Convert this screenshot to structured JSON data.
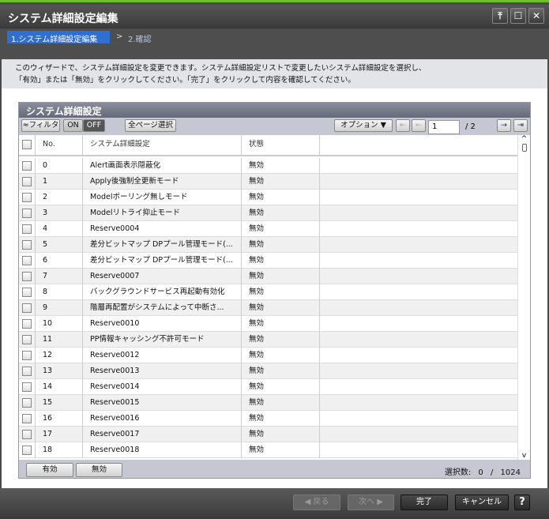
{
  "window": {
    "title": "システム詳細設定編集",
    "buttons": [
      "pin",
      "maximize",
      "close"
    ]
  },
  "wizard": {
    "steps": [
      "1.システム詳細設定編集",
      "2.確認"
    ],
    "separator": ">",
    "active_step": 0
  },
  "description": [
    "このウィザードで、システム詳細設定を変更できます。システム詳細設定リストで変更したいシステム詳細設定を選択し、",
    "「有効」または「無効」をクリックしてください。「完了」をクリックして内容を確認してください。"
  ],
  "panel": {
    "title": "システム詳細設定",
    "toolbar": {
      "filter": "≈フィルタ",
      "on": "ON",
      "off": "OFF",
      "select_all": "全ページ選択",
      "options": "オプション ▼",
      "page": "1",
      "total_pages": "/ 2"
    },
    "columns": [
      "No.",
      "システム詳細設定",
      "状態"
    ],
    "rows": [
      {
        "no": "0",
        "name": "Alert画面表示隠蔽化",
        "state": "無効"
      },
      {
        "no": "1",
        "name": "Apply後強制全更新モード",
        "state": "無効"
      },
      {
        "no": "2",
        "name": "Modelポーリング無しモード",
        "state": "無効"
      },
      {
        "no": "3",
        "name": "Modelリトライ抑止モード",
        "state": "無効"
      },
      {
        "no": "4",
        "name": "Reserve0004",
        "state": "無効"
      },
      {
        "no": "5",
        "name": "差分ビットマップ DPプール管理モード(...",
        "state": "無効"
      },
      {
        "no": "6",
        "name": "差分ビットマップ DPプール管理モード(...",
        "state": "無効"
      },
      {
        "no": "7",
        "name": "Reserve0007",
        "state": "無効"
      },
      {
        "no": "8",
        "name": "バックグラウンドサービス再起動有効化",
        "state": "無効"
      },
      {
        "no": "9",
        "name": "階層再配置がシステムによって中断さ...",
        "state": "無効"
      },
      {
        "no": "10",
        "name": "Reserve0010",
        "state": "無効"
      },
      {
        "no": "11",
        "name": "PP情報キャッシング不許可モード",
        "state": "無効"
      },
      {
        "no": "12",
        "name": "Reserve0012",
        "state": "無効"
      },
      {
        "no": "13",
        "name": "Reserve0013",
        "state": "無効"
      },
      {
        "no": "14",
        "name": "Reserve0014",
        "state": "無効"
      },
      {
        "no": "15",
        "name": "Reserve0015",
        "state": "無効"
      },
      {
        "no": "16",
        "name": "Reserve0016",
        "state": "無効"
      },
      {
        "no": "17",
        "name": "Reserve0017",
        "state": "無効"
      },
      {
        "no": "18",
        "name": "Reserve0018",
        "state": "無効"
      }
    ],
    "footer": {
      "enable": "有効",
      "disable": "無効",
      "selected_label": "選択数:",
      "selected": "0",
      "separator": "/",
      "total": "1024"
    }
  },
  "bottom": {
    "back": "◀ 戻る",
    "next": "次へ ▶",
    "finish": "完了",
    "cancel": "キャンセル",
    "help": "?"
  }
}
